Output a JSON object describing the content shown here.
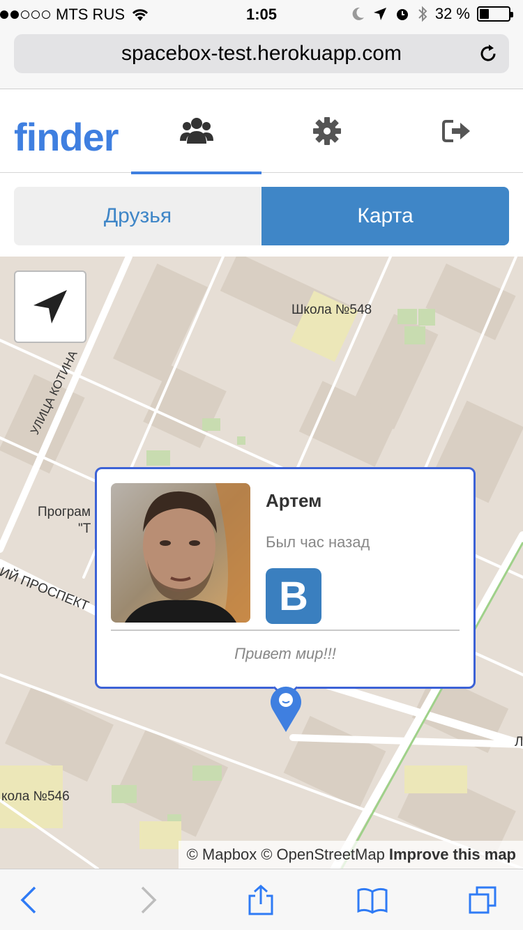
{
  "status_bar": {
    "carrier": "MTS RUS",
    "time": "1:05",
    "battery": "32 %",
    "signal_bars_filled": 2,
    "signal_bars_total": 5,
    "battery_level_percent": 32
  },
  "browser": {
    "url": "spacebox-test.herokuapp.com",
    "reload_icon": "reload-icon"
  },
  "app_nav": {
    "logo": "finder",
    "tabs": [
      {
        "icon": "friends-icon",
        "active": true
      },
      {
        "icon": "gear-icon",
        "active": false
      },
      {
        "icon": "logout-icon",
        "active": false
      }
    ]
  },
  "segments": {
    "friends": "Друзья",
    "map": "Карта",
    "selected": "map"
  },
  "map": {
    "labels": {
      "school_548": "Школа №548",
      "street_kotina": "УЛИЦА КОТИНА",
      "program_a": "Програм",
      "program_b": "\"Т",
      "prospect": "ИЙ ПРОСПЕКТ",
      "school_546": "кола №546",
      "street_right": "Л"
    },
    "attribution": {
      "mapbox": "© Mapbox",
      "osm": "© OpenStreetMap",
      "improve": "Improve this map"
    }
  },
  "popup": {
    "name": "Артем",
    "status": "Был час назад",
    "vk_label": "B",
    "message": "Привет мир!!!"
  },
  "colors": {
    "accent": "#3f86c7",
    "logo": "#3f7fe0",
    "popup_border": "#3c62d6",
    "vk": "#3a7fbf",
    "map_bg": "#e6ded5"
  },
  "toolbar": {
    "icons": [
      "back-icon",
      "forward-icon",
      "share-icon",
      "bookmarks-icon",
      "tabs-icon"
    ]
  }
}
